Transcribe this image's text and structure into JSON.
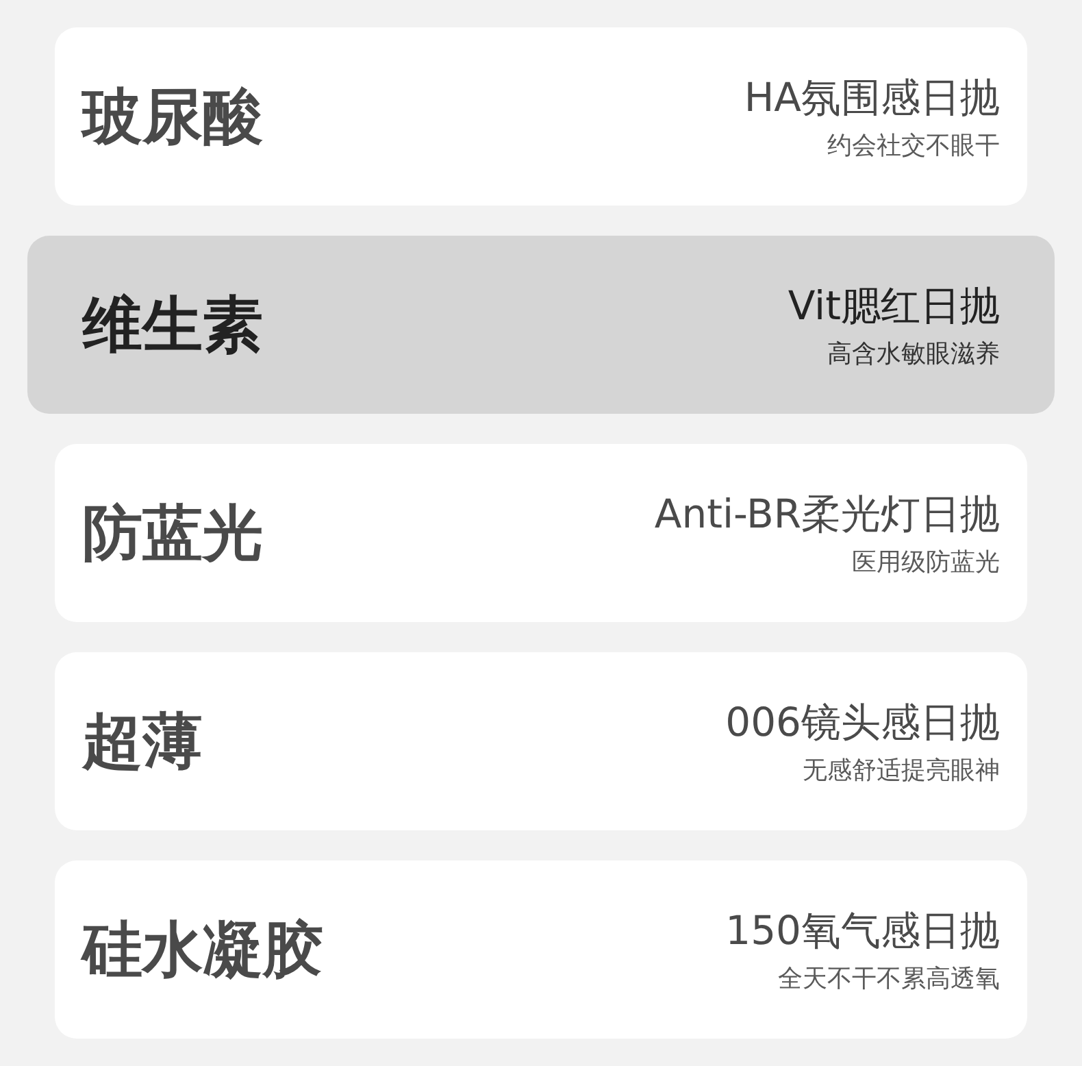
{
  "options": [
    {
      "name": "玻尿酸",
      "title": "HA氛围感日抛",
      "subtitle": "约会社交不眼干",
      "selected": false
    },
    {
      "name": "维生素",
      "title": "Vit腮红日抛",
      "subtitle": "高含水敏眼滋养",
      "selected": true
    },
    {
      "name": "防蓝光",
      "title": "Anti-BR柔光灯日抛",
      "subtitle": "医用级防蓝光",
      "selected": false
    },
    {
      "name": "超薄",
      "title": "006镜头感日抛",
      "subtitle": "无感舒适提亮眼神",
      "selected": false
    },
    {
      "name": "硅水凝胶",
      "title": "150氧气感日抛",
      "subtitle": "全天不干不累高透氧",
      "selected": false
    }
  ]
}
